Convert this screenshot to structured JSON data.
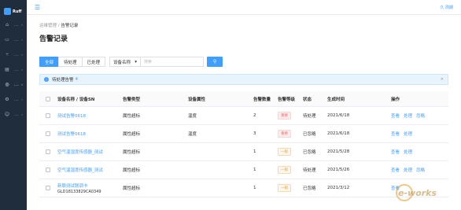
{
  "sidebar": {
    "logo_text": "Ruff",
    "items": [
      {
        "icon": "home-icon",
        "glyph": "⌂",
        "dots": "...",
        "arrow": "›"
      },
      {
        "icon": "device-icon",
        "glyph": "▭",
        "dots": "...",
        "arrow": "›"
      },
      {
        "icon": "flow-icon",
        "glyph": "⑂",
        "dots": "...",
        "arrow": "›"
      },
      {
        "icon": "data-icon",
        "glyph": "▤",
        "dots": "...",
        "arrow": "›"
      },
      {
        "icon": "alarm-icon",
        "glyph": "◎",
        "dots": "...",
        "arrow": "›"
      },
      {
        "icon": "settings-icon",
        "glyph": "⚙",
        "dots": "...",
        "arrow": "›"
      },
      {
        "icon": "user-icon",
        "glyph": "☺",
        "dots": "...",
        "arrow": "›"
      }
    ]
  },
  "topbar": {
    "menu_glyph": "☰",
    "user_label": "久 周期"
  },
  "breadcrumb": {
    "parent": "运维管理",
    "sep": " / ",
    "current": "告警记录"
  },
  "page_title": "告警记录",
  "filters": {
    "tabs": [
      "全部",
      "待处理",
      "已处理"
    ],
    "active_tab": 0,
    "select_value": "设备名称",
    "select_arrow": "▾",
    "search_placeholder": "搜索",
    "search_glyph": "⚲"
  },
  "alert": {
    "icon_glyph": "!",
    "text": "待处理告警",
    "count": "4",
    "close": "✕"
  },
  "table": {
    "headers": [
      "设备名称 / 设备SN",
      "告警类型",
      "设备属性",
      "告警数量",
      "告警等级",
      "状态",
      "生成时间",
      "操作"
    ],
    "rows": [
      {
        "name": "测试告警0618",
        "sn": "",
        "type": "属性超标",
        "attr": "温度",
        "count": "2",
        "level": "重要",
        "level_kind": "severe",
        "status": "待处理",
        "time": "2021/6/18",
        "ops": [
          "查看",
          "处理",
          "忽略"
        ]
      },
      {
        "name": "测试告警0618",
        "sn": "",
        "type": "属性超标",
        "attr": "温度",
        "count": "3",
        "level": "重要",
        "level_kind": "severe",
        "status": "已忽略",
        "time": "2021/6/18",
        "ops": [
          "查看",
          "处理"
        ]
      },
      {
        "name": "空气温湿度传感器_测试",
        "sn": "",
        "type": "属性超标",
        "attr": "",
        "count": "1",
        "level": "一般",
        "level_kind": "normal",
        "status": "已忽略",
        "time": "2021/5/28",
        "ops": [
          "查看",
          "处理"
        ]
      },
      {
        "name": "空气温湿度传感器_测试",
        "sn": "",
        "type": "属性超标",
        "attr": "",
        "count": "1",
        "level": "一般",
        "level_kind": "normal",
        "status": "待处理",
        "time": "2021/5/26",
        "ops": [
          "查看",
          "处理",
          "忽略"
        ]
      },
      {
        "name": "新联测试联调卡",
        "sn": "GLD18133829CA0349",
        "type": "属性超标",
        "attr": "",
        "count": "1",
        "level": "一般",
        "level_kind": "normal",
        "status": "已忽略",
        "time": "2021/3/12",
        "ops": [
          "查看"
        ]
      }
    ]
  },
  "watermark": {
    "text": "e-works"
  }
}
